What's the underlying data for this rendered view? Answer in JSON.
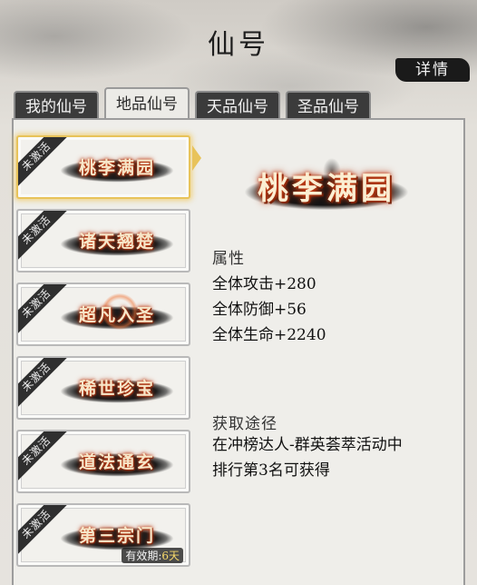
{
  "header": {
    "title": "仙号",
    "detail_label": "详情"
  },
  "tabs": [
    {
      "label": "我的仙号",
      "active": false
    },
    {
      "label": "地品仙号",
      "active": true
    },
    {
      "label": "天品仙号",
      "active": false
    },
    {
      "label": "圣品仙号",
      "active": false
    }
  ],
  "titles_list": [
    {
      "name": "桃李满园",
      "status": "未激活",
      "selected": true
    },
    {
      "name": "诸天翘楚",
      "status": "未激活"
    },
    {
      "name": "超凡入圣",
      "status": "未激活"
    },
    {
      "name": "稀世珍宝",
      "status": "未激活"
    },
    {
      "name": "道法通玄",
      "status": "未激活"
    },
    {
      "name": "第三宗门",
      "status": "未激活",
      "validity_label": "有效期:",
      "validity_value": "6天"
    }
  ],
  "detail": {
    "name": "桃李满园",
    "attributes_title": "属性",
    "attributes": [
      "全体攻击+280",
      "全体防御+56",
      "全体生命+2240"
    ],
    "source_title": "获取途径",
    "source_lines": [
      "在冲榜达人-群英荟萃活动中",
      "排行第3名可获得"
    ]
  },
  "colors": {
    "highlight": "#e8c35a",
    "title_glow": "#c8401a",
    "tab_dark": "#3b3b3b"
  }
}
